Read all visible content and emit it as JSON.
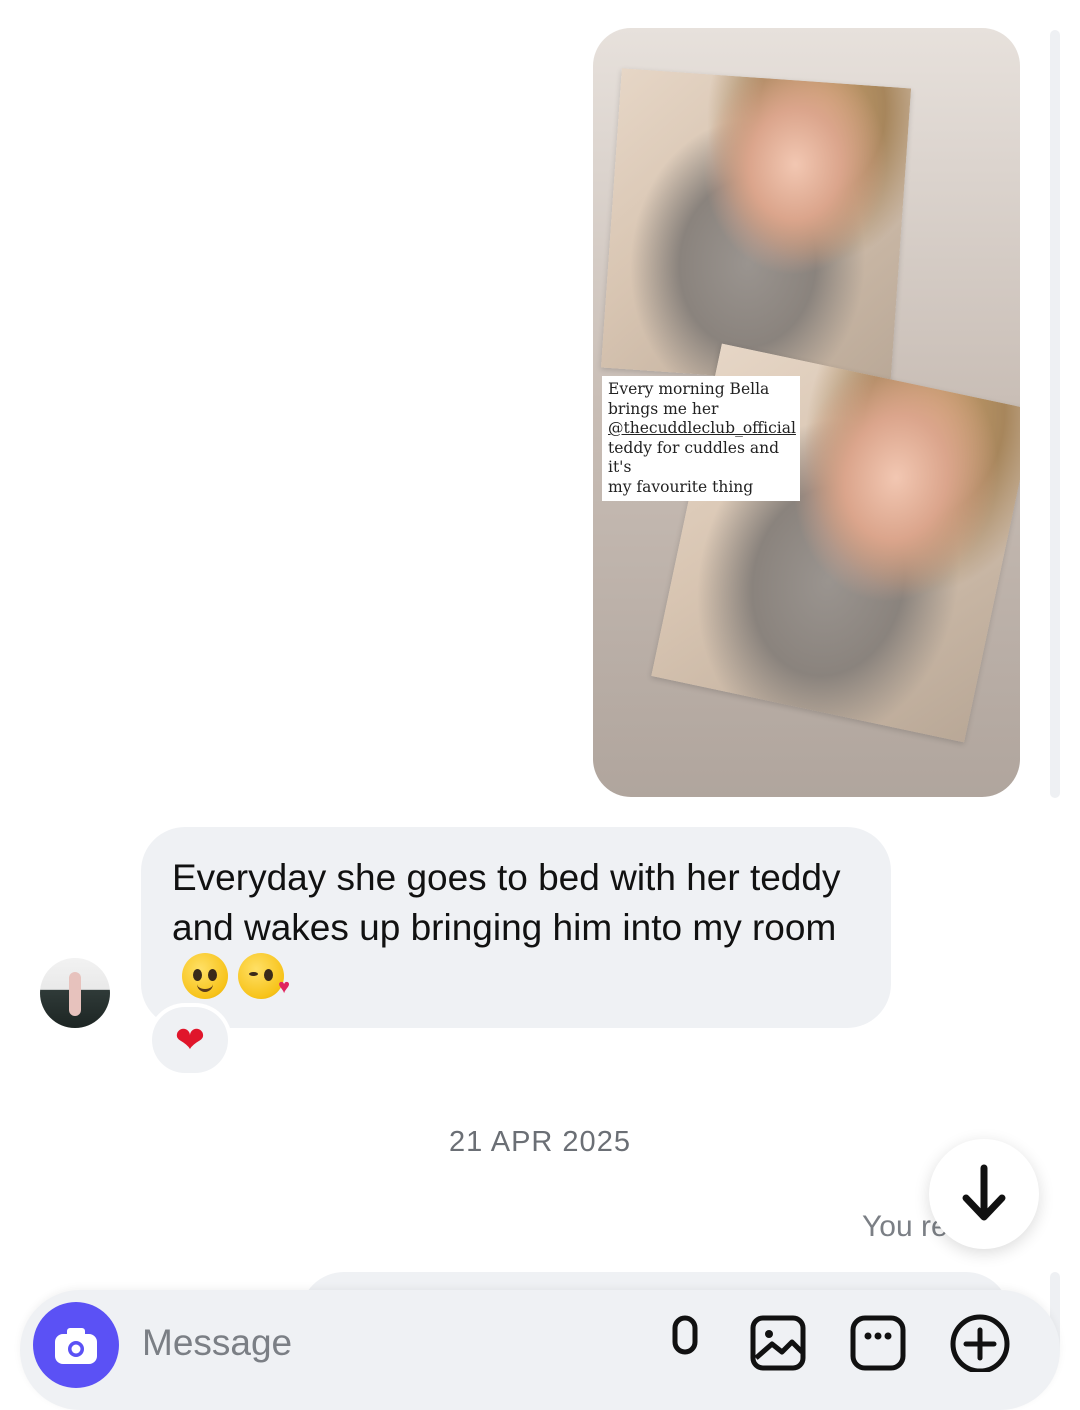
{
  "story": {
    "caption_line1": "Every morning Bella",
    "caption_line2": "brings me her",
    "caption_mention": "@thecuddleclub_official",
    "caption_line4": "teddy for cuddles and it's",
    "caption_line5": "my favourite thing"
  },
  "message": {
    "text": "Everyday she goes to bed with her teddy and wakes up bringing him into my room",
    "emojis": [
      "pleading-face-icon",
      "face-blowing-kiss-icon"
    ],
    "reaction": "❤️"
  },
  "date_separator": "21 APR 2025",
  "you_replied": "You re",
  "composer": {
    "placeholder": "Message"
  },
  "colors": {
    "accent": "#5b51f5",
    "bubble": "#eff1f4",
    "heart": "#e0162b"
  },
  "icons": [
    "arrow-down-icon",
    "camera-icon",
    "microphone-icon",
    "gallery-icon",
    "sticker-icon",
    "plus-icon"
  ]
}
